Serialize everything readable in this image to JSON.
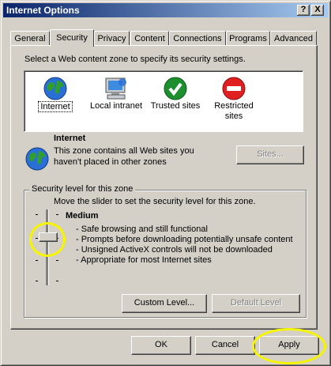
{
  "window": {
    "title": "Internet Options",
    "help_btn": "?",
    "close_btn": "X"
  },
  "tabs": [
    {
      "label": "General"
    },
    {
      "label": "Security"
    },
    {
      "label": "Privacy"
    },
    {
      "label": "Content"
    },
    {
      "label": "Connections"
    },
    {
      "label": "Programs"
    },
    {
      "label": "Advanced"
    }
  ],
  "security": {
    "zone_prompt": "Select a Web content zone to specify its security settings.",
    "zones": [
      {
        "label": "Internet",
        "icon": "globe-icon"
      },
      {
        "label": "Local intranet",
        "icon": "computer-icon"
      },
      {
        "label": "Trusted sites",
        "icon": "checkmark-icon"
      },
      {
        "label": "Restricted sites",
        "icon": "no-entry-icon"
      }
    ],
    "selected_zone": {
      "name": "Internet",
      "desc_line1": "This zone contains all Web sites you",
      "desc_line2": "haven't placed in other zones"
    },
    "sites_button": "Sites...",
    "level_group_title": "Security level for this zone",
    "slider_hint": "Move the slider to set the security level for this zone.",
    "level_name": "Medium",
    "level_bullets": [
      "- Safe browsing and still functional",
      "- Prompts before downloading potentially unsafe content",
      "- Unsigned ActiveX controls will not be downloaded",
      "- Appropriate for most Internet sites"
    ],
    "slider": {
      "level": "Medium",
      "position_of_4": 3
    },
    "custom_level_button": "Custom Level...",
    "default_level_button": "Default Level"
  },
  "footer": {
    "ok": "OK",
    "cancel": "Cancel",
    "apply": "Apply"
  },
  "colors": {
    "highlight_ring": "#f5f500",
    "title_bar": "#0a246a",
    "face": "#d4d0c8"
  }
}
